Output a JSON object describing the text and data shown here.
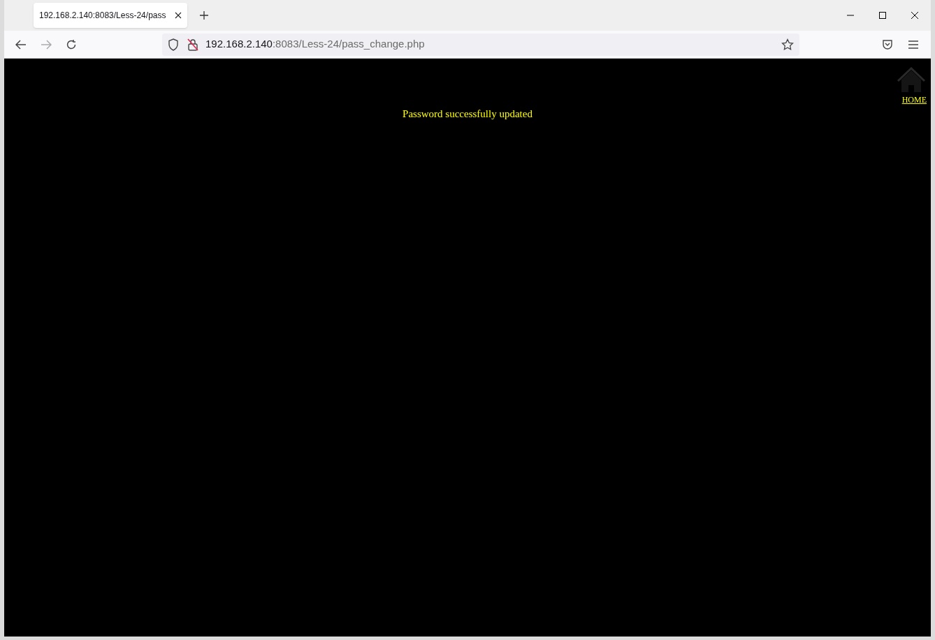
{
  "tabs": [
    {
      "title": "192.168.2.140:8083/Less-24/pass",
      "selected": true
    }
  ],
  "address_bar": {
    "host": "192.168.2.140",
    "path": ":8083/Less-24/pass_change.php"
  },
  "page": {
    "message": "Password successfully updated",
    "home_link": "HOME"
  }
}
